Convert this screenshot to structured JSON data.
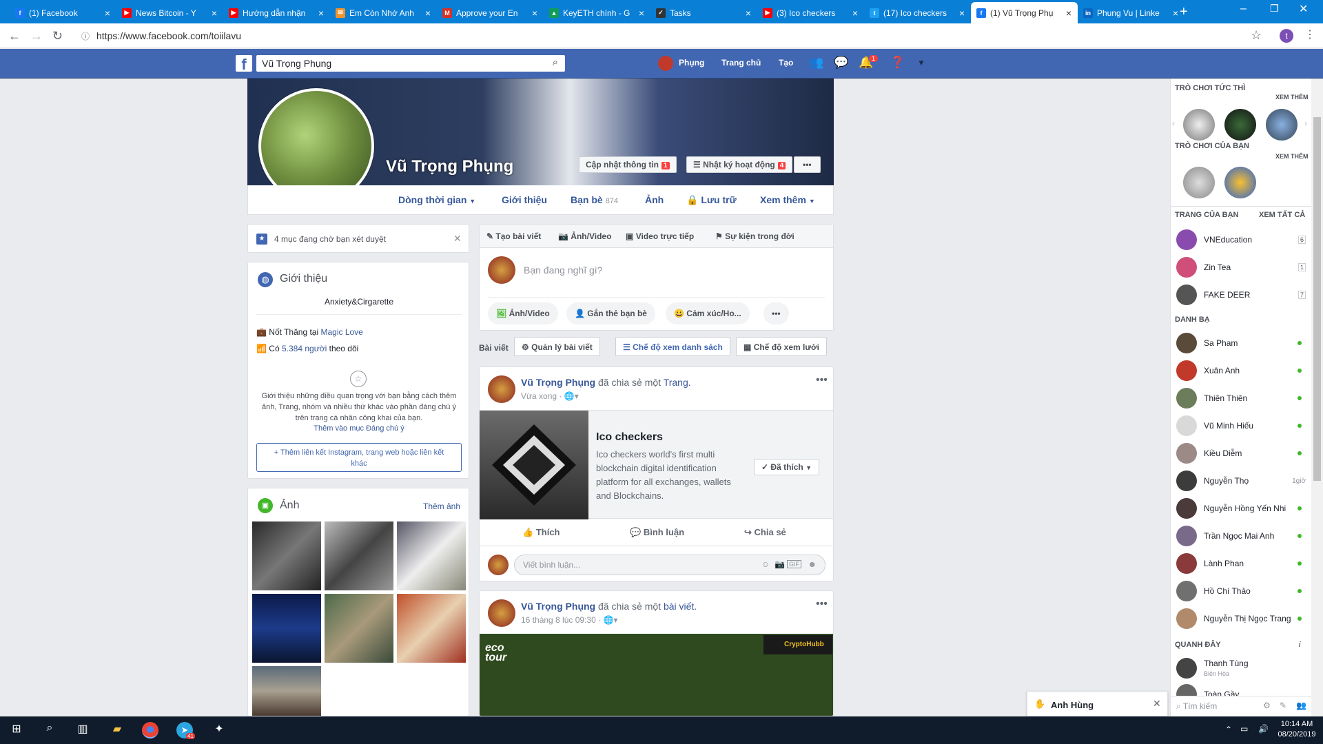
{
  "browser": {
    "tabs": [
      {
        "title": "(1) Facebook",
        "color": "#1877f2",
        "letter": "f"
      },
      {
        "title": "News Bitcoin - Y",
        "color": "#ff0000",
        "letter": "▶"
      },
      {
        "title": "Hướng dẫn nhận",
        "color": "#ff0000",
        "letter": "▶"
      },
      {
        "title": "Em Còn Nhớ Anh",
        "color": "#f0932b",
        "letter": "✉"
      },
      {
        "title": "Approve your En",
        "color": "#d93025",
        "letter": "M"
      },
      {
        "title": "KeyETH chính - G",
        "color": "#0f9d58",
        "letter": "▲"
      },
      {
        "title": "Tasks",
        "color": "#333333",
        "letter": "✓"
      },
      {
        "title": "(3) Ico checkers",
        "color": "#ff0000",
        "letter": "▶"
      },
      {
        "title": "(17) Ico checkers",
        "color": "#1da1f2",
        "letter": "t"
      },
      {
        "title": "(1) Vũ Trọng Phụ",
        "color": "#1877f2",
        "letter": "f"
      },
      {
        "title": "Phung Vu | Linke",
        "color": "#0a66c2",
        "letter": "in"
      }
    ],
    "url": "https://www.facebook.com/toiilavu",
    "profile_letter": "t"
  },
  "fb": {
    "search_value": "Vũ Trọng Phụng",
    "user_name": "Phụng",
    "home": "Trang chủ",
    "create": "Tạo",
    "notif_count": "1"
  },
  "profile": {
    "name": "Vũ Trọng Phụng",
    "update_info": "Cập nhật thông tin",
    "update_badge": "1",
    "activity_log": "Nhật ký hoạt động",
    "activity_badge": "4",
    "nav": {
      "timeline": "Dòng thời gian",
      "about": "Giới thiệu",
      "friends": "Bạn bè",
      "friends_count": "874",
      "photos": "Ảnh",
      "archive": "Lưu trữ",
      "more": "Xem thêm"
    }
  },
  "left": {
    "pending": "4 mục đang chờ bạn xét duyệt",
    "intro_title": "Giới thiệu",
    "bio": "Anxiety&Cirgarette",
    "works_prefix": "Nốt Thăng tại",
    "works_link": "Magic Love",
    "followers_prefix": "Có",
    "followers_link": "5.384 người",
    "followers_suffix": "theo dõi",
    "featured_text": "Giới thiệu những điều quan trọng với bạn bằng cách thêm ảnh, Trang, nhóm và nhiều thứ khác vào phần đáng chú ý trên trang cá nhân công khai của bạn.",
    "featured_link": "Thêm vào mục Đáng chú ý",
    "add_links": "Thêm liên kết Instagram, trang web hoặc liên kết khác",
    "photos_title": "Ảnh",
    "add_photo": "Thêm ảnh"
  },
  "composer": {
    "create_post": "Tạo bài viết",
    "photo_video": "Ảnh/Video",
    "live_video": "Video trực tiếp",
    "life_event": "Sự kiện trong đời",
    "placeholder": "Bạn đang nghĩ gì?",
    "pill_photo": "Ảnh/Video",
    "pill_tag": "Gắn thẻ bạn bè",
    "pill_feeling": "Cảm xúc/Ho..."
  },
  "posts_bar": {
    "label": "Bài viết",
    "manage": "Quản lý bài viết",
    "list_view": "Chế độ xem danh sách",
    "grid_view": "Chế độ xem lưới"
  },
  "post1": {
    "author": "Vũ Trọng Phụng",
    "action": "đã chia sẻ một",
    "object": "Trang.",
    "time": "Vừa xong",
    "page_title": "Ico checkers",
    "page_desc": "Ico checkers world's first multi blockchain digital identification platform for all exchanges, wallets and Blockchains.",
    "liked": "Đã thích",
    "like": "Thích",
    "comment": "Bình luận",
    "share": "Chia sẻ",
    "comment_placeholder": "Viết bình luận..."
  },
  "post2": {
    "author": "Vũ Trọng Phụng",
    "action": "đã chia sẻ một",
    "object": "bài viết.",
    "time": "16 tháng 8 lúc 09:30",
    "logo_text": "eco tour",
    "watermark": "CryptoHubb"
  },
  "right": {
    "instant_games": "Trò chơi tức thì",
    "see_more": "Xem thêm",
    "your_games": "Trò chơi của bạn",
    "see_more2": "Xem thêm",
    "your_pages": "Trang của bạn",
    "see_all": "Xem tất cả",
    "pages": [
      {
        "name": "VNEducation",
        "count": "6",
        "color": "#8a4baf"
      },
      {
        "name": "Zin Tea",
        "count": "1",
        "color": "#d04f7a"
      },
      {
        "name": "FAKE DEER",
        "count": "7",
        "color": "#555555"
      }
    ],
    "friends_head": "Danh bạ",
    "contacts": [
      {
        "name": "Sa Pham",
        "status": "online",
        "time": "",
        "color": "#5a4a3a"
      },
      {
        "name": "Xuân Anh",
        "status": "online",
        "time": "",
        "color": "#c0392b"
      },
      {
        "name": "Thiên Thiên",
        "status": "online",
        "time": "",
        "color": "#6b7d5a"
      },
      {
        "name": "Vũ Minh Hiếu",
        "status": "online",
        "time": "",
        "color": "#d9d9d9"
      },
      {
        "name": "Kiều Diễm",
        "status": "online",
        "time": "",
        "color": "#9b8a86"
      },
      {
        "name": "Nguyễn Thọ",
        "status": "",
        "time": "1giờ",
        "color": "#3c3c3c"
      },
      {
        "name": "Nguyễn Hồng Yến Nhi",
        "status": "online",
        "time": "",
        "color": "#4a3a3a"
      },
      {
        "name": "Trần Ngọc Mai Anh",
        "status": "online",
        "time": "",
        "color": "#7a6a8a"
      },
      {
        "name": "Lành Phan",
        "status": "online",
        "time": "",
        "color": "#8a3a3a"
      },
      {
        "name": "Hồ Chí Thảo",
        "status": "online",
        "time": "",
        "color": "#707070"
      },
      {
        "name": "Nguyễn Thị Ngọc Trang",
        "status": "online",
        "time": "",
        "color": "#b08a6a"
      }
    ],
    "recent_head": "Quanh đây",
    "recent": [
      {
        "name": "Thanh Tùng",
        "sub": "Biên Hòa",
        "color": "#444444"
      },
      {
        "name": "Toàn Gầy",
        "sub": "",
        "color": "#666666"
      }
    ],
    "search_placeholder": "Tìm kiếm"
  },
  "chat": {
    "name": "Anh Hùng"
  },
  "taskbar": {
    "time": "10:14 AM",
    "date": "08/20/2019",
    "telegram_badge": "41"
  }
}
